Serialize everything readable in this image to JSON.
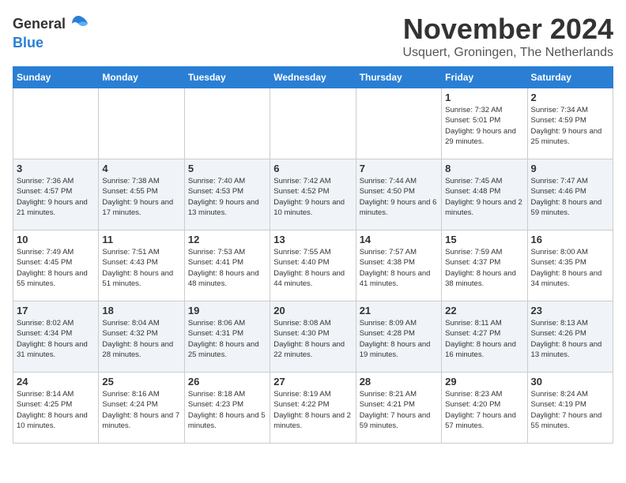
{
  "logo": {
    "general": "General",
    "blue": "Blue"
  },
  "title": "November 2024",
  "location": "Usquert, Groningen, The Netherlands",
  "days_of_week": [
    "Sunday",
    "Monday",
    "Tuesday",
    "Wednesday",
    "Thursday",
    "Friday",
    "Saturday"
  ],
  "weeks": [
    [
      {
        "day": "",
        "info": ""
      },
      {
        "day": "",
        "info": ""
      },
      {
        "day": "",
        "info": ""
      },
      {
        "day": "",
        "info": ""
      },
      {
        "day": "",
        "info": ""
      },
      {
        "day": "1",
        "info": "Sunrise: 7:32 AM\nSunset: 5:01 PM\nDaylight: 9 hours and 29 minutes."
      },
      {
        "day": "2",
        "info": "Sunrise: 7:34 AM\nSunset: 4:59 PM\nDaylight: 9 hours and 25 minutes."
      }
    ],
    [
      {
        "day": "3",
        "info": "Sunrise: 7:36 AM\nSunset: 4:57 PM\nDaylight: 9 hours and 21 minutes."
      },
      {
        "day": "4",
        "info": "Sunrise: 7:38 AM\nSunset: 4:55 PM\nDaylight: 9 hours and 17 minutes."
      },
      {
        "day": "5",
        "info": "Sunrise: 7:40 AM\nSunset: 4:53 PM\nDaylight: 9 hours and 13 minutes."
      },
      {
        "day": "6",
        "info": "Sunrise: 7:42 AM\nSunset: 4:52 PM\nDaylight: 9 hours and 10 minutes."
      },
      {
        "day": "7",
        "info": "Sunrise: 7:44 AM\nSunset: 4:50 PM\nDaylight: 9 hours and 6 minutes."
      },
      {
        "day": "8",
        "info": "Sunrise: 7:45 AM\nSunset: 4:48 PM\nDaylight: 9 hours and 2 minutes."
      },
      {
        "day": "9",
        "info": "Sunrise: 7:47 AM\nSunset: 4:46 PM\nDaylight: 8 hours and 59 minutes."
      }
    ],
    [
      {
        "day": "10",
        "info": "Sunrise: 7:49 AM\nSunset: 4:45 PM\nDaylight: 8 hours and 55 minutes."
      },
      {
        "day": "11",
        "info": "Sunrise: 7:51 AM\nSunset: 4:43 PM\nDaylight: 8 hours and 51 minutes."
      },
      {
        "day": "12",
        "info": "Sunrise: 7:53 AM\nSunset: 4:41 PM\nDaylight: 8 hours and 48 minutes."
      },
      {
        "day": "13",
        "info": "Sunrise: 7:55 AM\nSunset: 4:40 PM\nDaylight: 8 hours and 44 minutes."
      },
      {
        "day": "14",
        "info": "Sunrise: 7:57 AM\nSunset: 4:38 PM\nDaylight: 8 hours and 41 minutes."
      },
      {
        "day": "15",
        "info": "Sunrise: 7:59 AM\nSunset: 4:37 PM\nDaylight: 8 hours and 38 minutes."
      },
      {
        "day": "16",
        "info": "Sunrise: 8:00 AM\nSunset: 4:35 PM\nDaylight: 8 hours and 34 minutes."
      }
    ],
    [
      {
        "day": "17",
        "info": "Sunrise: 8:02 AM\nSunset: 4:34 PM\nDaylight: 8 hours and 31 minutes."
      },
      {
        "day": "18",
        "info": "Sunrise: 8:04 AM\nSunset: 4:32 PM\nDaylight: 8 hours and 28 minutes."
      },
      {
        "day": "19",
        "info": "Sunrise: 8:06 AM\nSunset: 4:31 PM\nDaylight: 8 hours and 25 minutes."
      },
      {
        "day": "20",
        "info": "Sunrise: 8:08 AM\nSunset: 4:30 PM\nDaylight: 8 hours and 22 minutes."
      },
      {
        "day": "21",
        "info": "Sunrise: 8:09 AM\nSunset: 4:28 PM\nDaylight: 8 hours and 19 minutes."
      },
      {
        "day": "22",
        "info": "Sunrise: 8:11 AM\nSunset: 4:27 PM\nDaylight: 8 hours and 16 minutes."
      },
      {
        "day": "23",
        "info": "Sunrise: 8:13 AM\nSunset: 4:26 PM\nDaylight: 8 hours and 13 minutes."
      }
    ],
    [
      {
        "day": "24",
        "info": "Sunrise: 8:14 AM\nSunset: 4:25 PM\nDaylight: 8 hours and 10 minutes."
      },
      {
        "day": "25",
        "info": "Sunrise: 8:16 AM\nSunset: 4:24 PM\nDaylight: 8 hours and 7 minutes."
      },
      {
        "day": "26",
        "info": "Sunrise: 8:18 AM\nSunset: 4:23 PM\nDaylight: 8 hours and 5 minutes."
      },
      {
        "day": "27",
        "info": "Sunrise: 8:19 AM\nSunset: 4:22 PM\nDaylight: 8 hours and 2 minutes."
      },
      {
        "day": "28",
        "info": "Sunrise: 8:21 AM\nSunset: 4:21 PM\nDaylight: 7 hours and 59 minutes."
      },
      {
        "day": "29",
        "info": "Sunrise: 8:23 AM\nSunset: 4:20 PM\nDaylight: 7 hours and 57 minutes."
      },
      {
        "day": "30",
        "info": "Sunrise: 8:24 AM\nSunset: 4:19 PM\nDaylight: 7 hours and 55 minutes."
      }
    ]
  ]
}
